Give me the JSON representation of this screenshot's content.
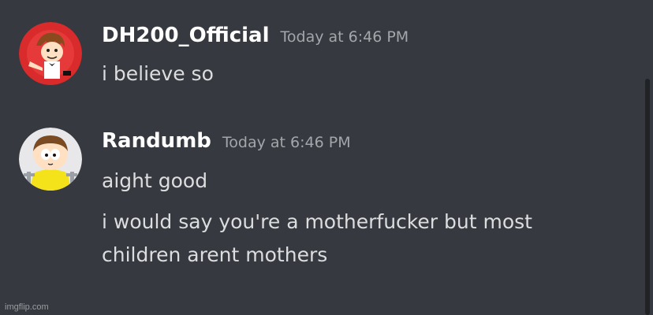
{
  "messages": [
    {
      "username": "DH200_Official",
      "timestamp": "Today at 6:46 PM",
      "avatar_icon": "red-cartoon-avatar",
      "lines": [
        "i believe so"
      ]
    },
    {
      "username": "Randumb",
      "timestamp": "Today at 6:46 PM",
      "avatar_icon": "south-park-cartoon-avatar",
      "lines": [
        "aight good",
        "i would say you're a motherfucker but most",
        "children arent mothers"
      ]
    }
  ],
  "watermark": "imgflip.com",
  "colors": {
    "background": "#36393f",
    "username": "#ffffff",
    "timestamp": "#a3a6aa",
    "message_text": "#dcddde"
  }
}
